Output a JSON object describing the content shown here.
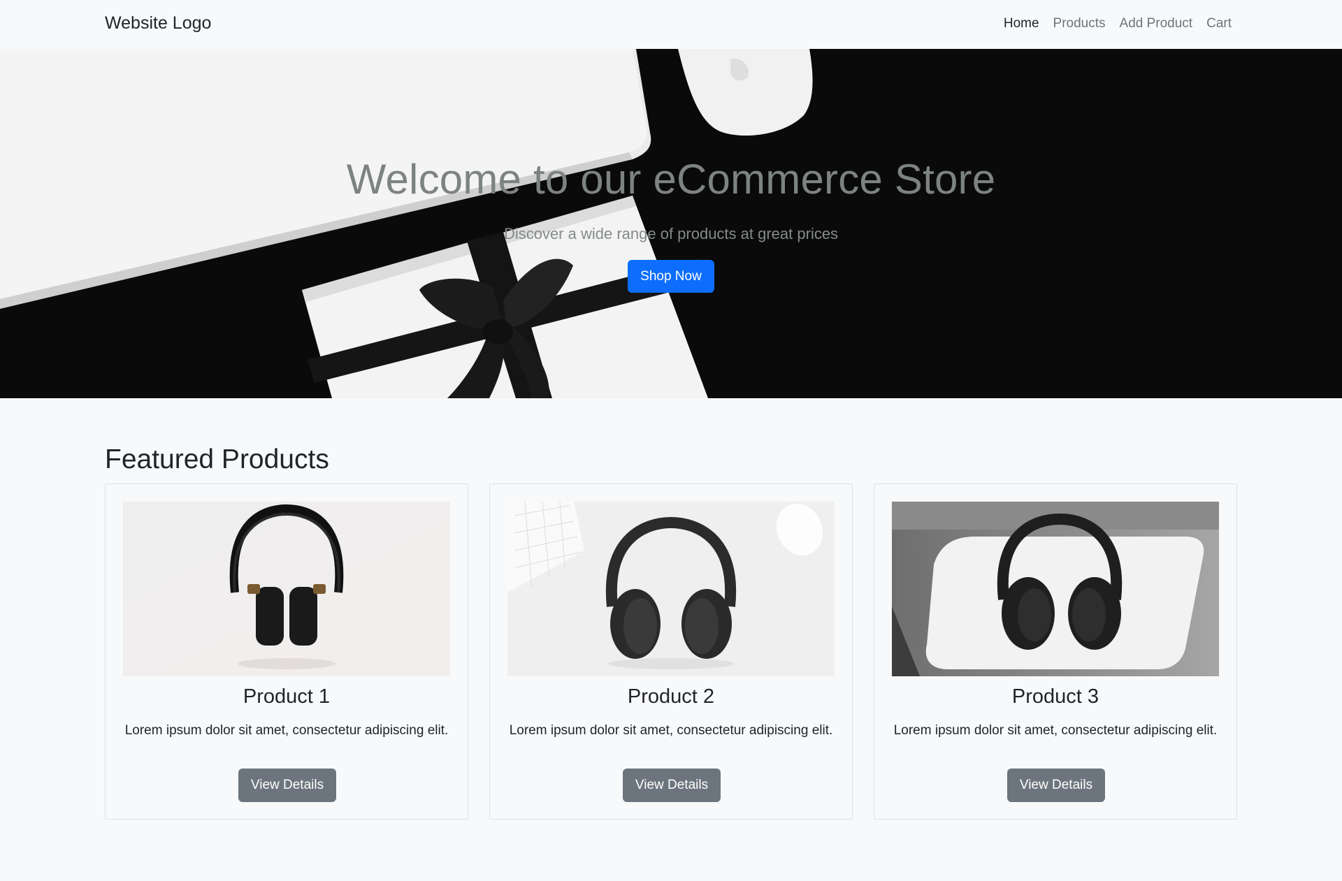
{
  "navbar": {
    "brand": "Website Logo",
    "links": [
      {
        "label": "Home",
        "active": true
      },
      {
        "label": "Products",
        "active": false
      },
      {
        "label": "Add Product",
        "active": false
      },
      {
        "label": "Cart",
        "active": false
      }
    ]
  },
  "hero": {
    "title": "Welcome to our eCommerce Store",
    "subtitle": "Discover a wide range of products at great prices",
    "cta_label": "Shop Now",
    "image_icon": "laptop-gift-photo"
  },
  "featured": {
    "title": "Featured Products",
    "products": [
      {
        "name": "Product 1",
        "description": "Lorem ipsum dolor sit amet, consectetur adipiscing elit.",
        "button_label": "View Details",
        "image_icon": "headphones-photo"
      },
      {
        "name": "Product 2",
        "description": "Lorem ipsum dolor sit amet, consectetur adipiscing elit.",
        "button_label": "View Details",
        "image_icon": "headphones-photo"
      },
      {
        "name": "Product 3",
        "description": "Lorem ipsum dolor sit amet, consectetur adipiscing elit.",
        "button_label": "View Details",
        "image_icon": "headphones-photo"
      }
    ]
  },
  "colors": {
    "primary": "#0d6efd",
    "secondary": "#6c757d",
    "background": "#f8f9fa",
    "text": "#212529"
  }
}
